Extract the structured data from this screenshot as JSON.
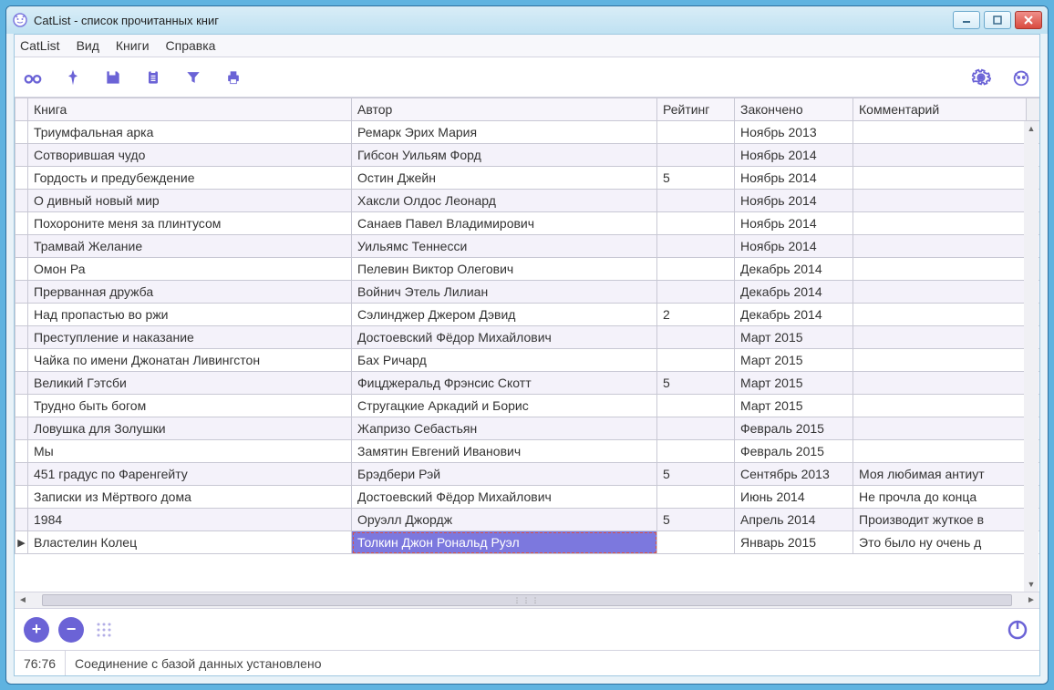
{
  "window": {
    "title": "CatList - список прочитанных книг"
  },
  "menu": {
    "items": [
      "CatList",
      "Вид",
      "Книги",
      "Справка"
    ]
  },
  "toolbar_icons": [
    "binoculars",
    "pin",
    "save",
    "clipboard",
    "filter",
    "print"
  ],
  "toolbar_right_icons": [
    "gear",
    "cat"
  ],
  "columns": {
    "book": "Книга",
    "author": "Автор",
    "rating": "Рейтинг",
    "finished": "Закончено",
    "comment": "Комментарий"
  },
  "rows": [
    {
      "book": "Триумфальная арка",
      "author": "Ремарк Эрих Мария",
      "rating": "",
      "finished": "Ноябрь 2013",
      "comment": ""
    },
    {
      "book": "Сотворившая чудо",
      "author": "Гибсон Уильям Форд",
      "rating": "",
      "finished": "Ноябрь 2014",
      "comment": ""
    },
    {
      "book": "Гордость и предубеждение",
      "author": "Остин Джейн",
      "rating": "5",
      "finished": "Ноябрь 2014",
      "comment": ""
    },
    {
      "book": "О дивный новый мир",
      "author": "Хаксли Олдос Леонард",
      "rating": "",
      "finished": "Ноябрь 2014",
      "comment": ""
    },
    {
      "book": "Похороните меня за плинтусом",
      "author": "Санаев Павел Владимирович",
      "rating": "",
      "finished": "Ноябрь 2014",
      "comment": ""
    },
    {
      "book": "Трамвай Желание",
      "author": "Уильямс Теннесси",
      "rating": "",
      "finished": "Ноябрь 2014",
      "comment": ""
    },
    {
      "book": "Омон Ра",
      "author": "Пелевин Виктор Олегович",
      "rating": "",
      "finished": "Декабрь 2014",
      "comment": ""
    },
    {
      "book": "Прерванная дружба",
      "author": "Войнич Этель Лилиан",
      "rating": "",
      "finished": "Декабрь 2014",
      "comment": ""
    },
    {
      "book": "Над пропастью во ржи",
      "author": "Сэлинджер Джером Дэвид",
      "rating": "2",
      "finished": "Декабрь 2014",
      "comment": ""
    },
    {
      "book": "Преступление и наказание",
      "author": "Достоевский Фёдор Михайлович",
      "rating": "",
      "finished": "Март 2015",
      "comment": ""
    },
    {
      "book": "Чайка по имени Джонатан Ливингстон",
      "author": "Бах Ричард",
      "rating": "",
      "finished": "Март 2015",
      "comment": ""
    },
    {
      "book": "Великий Гэтсби",
      "author": "Фицджеральд Фрэнсис Скотт",
      "rating": "5",
      "finished": "Март 2015",
      "comment": ""
    },
    {
      "book": "Трудно быть богом",
      "author": "Стругацкие Аркадий и Борис",
      "rating": "",
      "finished": "Март 2015",
      "comment": ""
    },
    {
      "book": "Ловушка для Золушки",
      "author": "Жапризо Себастьян",
      "rating": "",
      "finished": "Февраль 2015",
      "comment": ""
    },
    {
      "book": "Мы",
      "author": "Замятин Евгений Иванович",
      "rating": "",
      "finished": "Февраль 2015",
      "comment": ""
    },
    {
      "book": "451 градус по Фаренгейту",
      "author": "Брэдбери Рэй",
      "rating": "5",
      "finished": "Сентябрь 2013",
      "comment": "Моя любимая антиут"
    },
    {
      "book": "Записки из Мёртвого дома",
      "author": "Достоевский Фёдор Михайлович",
      "rating": "",
      "finished": "Июнь 2014",
      "comment": "Не прочла до конца"
    },
    {
      "book": "1984",
      "author": "Оруэлл Джордж",
      "rating": "5",
      "finished": "Апрель 2014",
      "comment": "Производит жуткое в"
    },
    {
      "book": "Властелин Колец",
      "author": "Толкин Джон Рональд Руэл",
      "rating": "",
      "finished": "Январь 2015",
      "comment": "Это было ну очень д"
    }
  ],
  "selected_row_index": 18,
  "selected_col": "author",
  "status": {
    "counter": "76:76",
    "message": "Соединение с базой данных установлено"
  },
  "buttons": {
    "add": "+",
    "remove": "−"
  }
}
